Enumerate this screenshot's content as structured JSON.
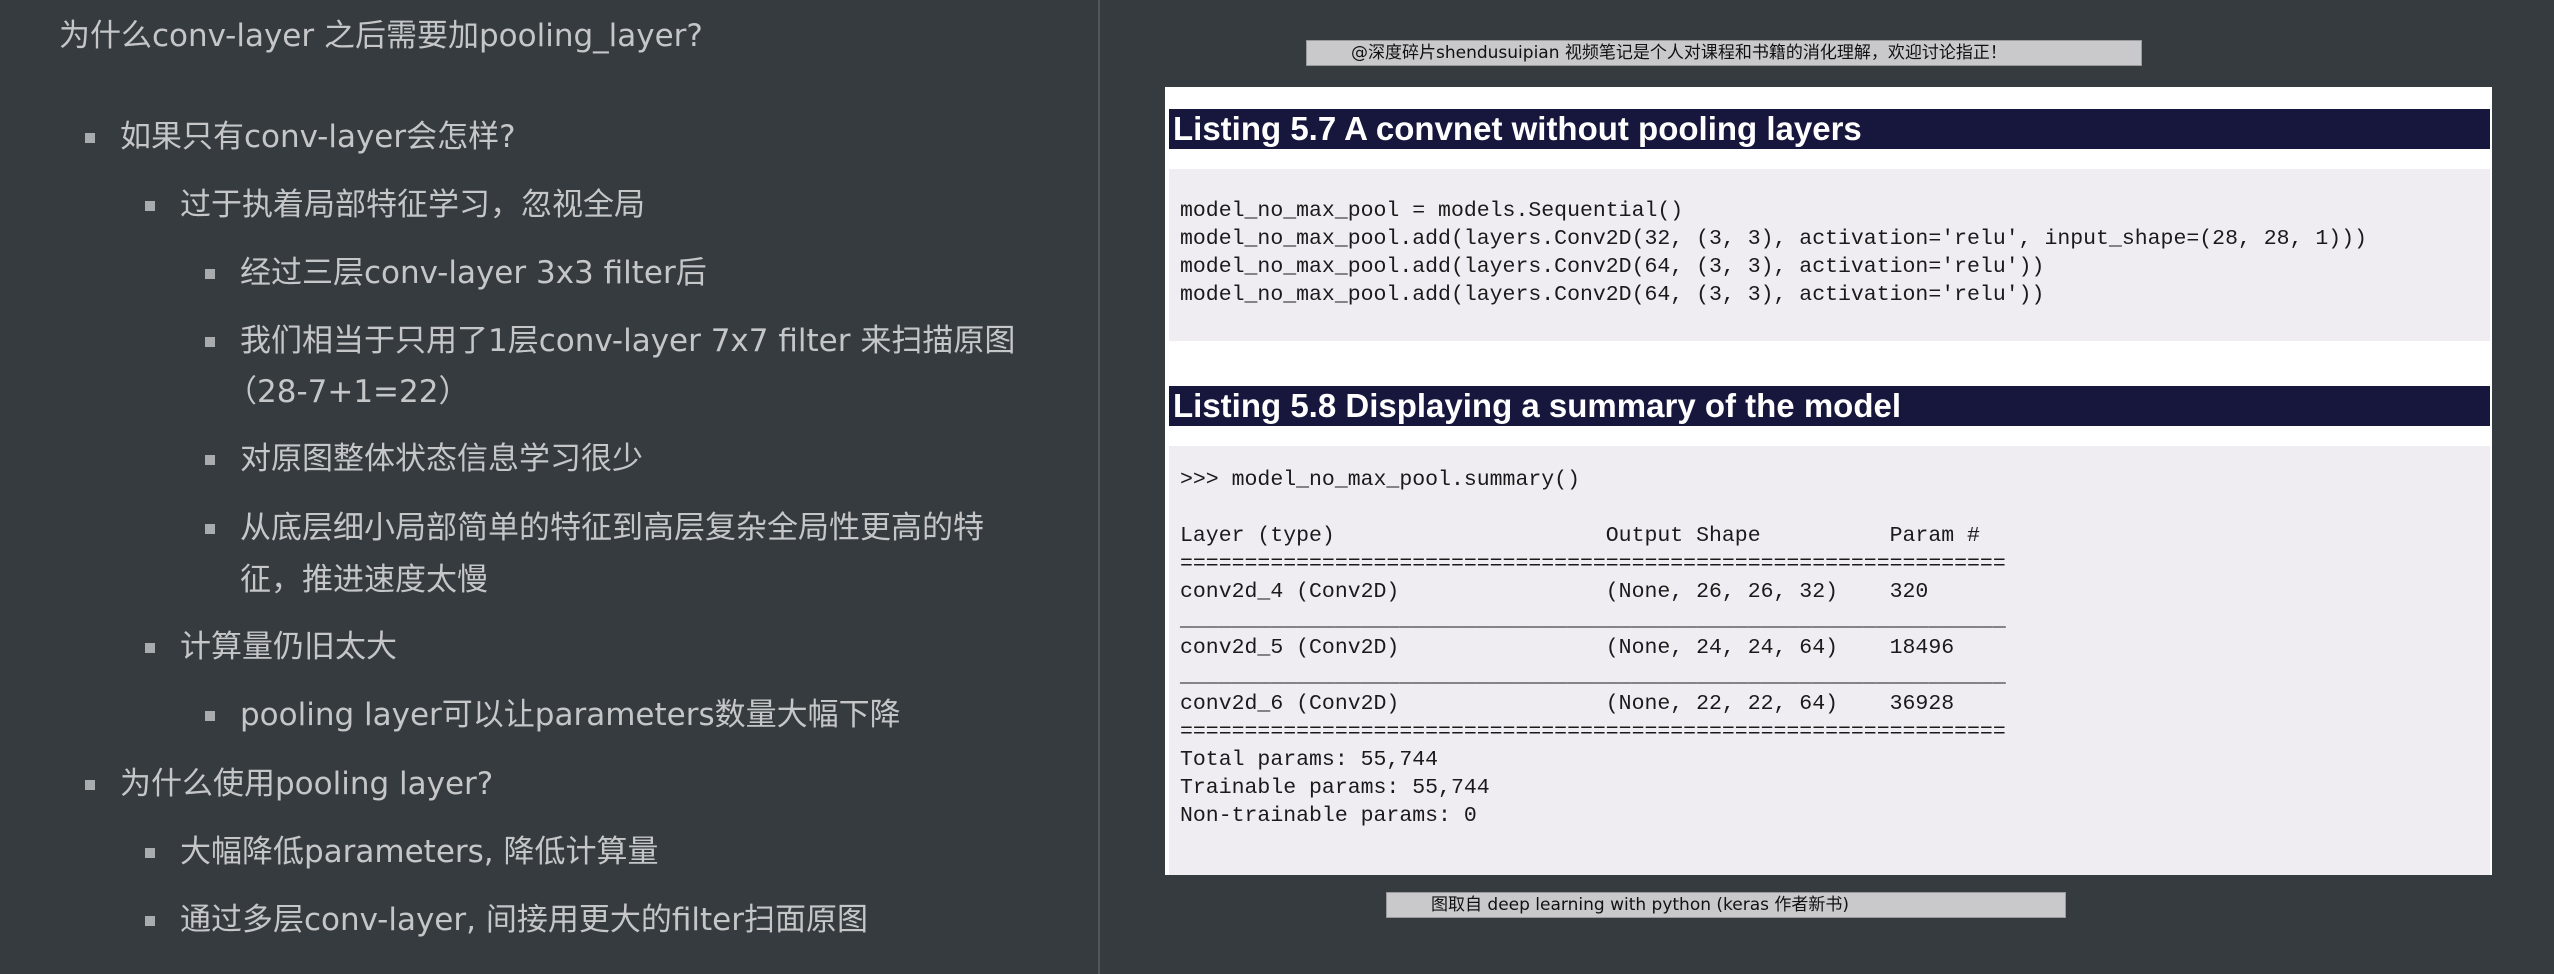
{
  "notes": {
    "title": "为什么conv-layer 之后需要加pooling_layer?",
    "items": [
      {
        "level": 1,
        "text": "如果只有conv-layer会怎样?"
      },
      {
        "level": 2,
        "text": "过于执着局部特征学习，忽视全局"
      },
      {
        "level": 3,
        "text": "经过三层conv-layer 3x3 filter后"
      },
      {
        "level": 3,
        "text": "我们相当于只用了1层conv-layer 7x7 filter 来扫描原图"
      },
      {
        "level": 3,
        "text": "（28-7+1=22）",
        "continuation": true
      },
      {
        "level": 3,
        "text": "对原图整体状态信息学习很少"
      },
      {
        "level": 3,
        "text": "从底层细小局部简单的特征到高层复杂全局性更高的特"
      },
      {
        "level": 3,
        "text": "征，推进速度太慢",
        "continuation": true
      },
      {
        "level": 2,
        "text": "计算量仍旧太大"
      },
      {
        "level": 3,
        "text": "pooling layer可以让parameters数量大幅下降"
      },
      {
        "level": 1,
        "text": "为什么使用pooling layer?"
      },
      {
        "level": 2,
        "text": "大幅降低parameters, 降低计算量"
      },
      {
        "level": 2,
        "text": "通过多层conv-layer, 间接用更大的filter扫面原图"
      }
    ]
  },
  "book": {
    "watermark": "@深度碎片shendusuipian 视频笔记是个人对课程和书籍的消化理解，欢迎讨论指正！",
    "caption": "图取自 deep learning with python (keras 作者新书)",
    "listing_57": {
      "title": "Listing 5.7 A convnet without pooling layers",
      "code": [
        "model_no_max_pool = models.Sequential()",
        "model_no_max_pool.add(layers.Conv2D(32, (3, 3), activation='relu', input_shape=(28, 28, 1)))",
        "model_no_max_pool.add(layers.Conv2D(64, (3, 3), activation='relu'))",
        "model_no_max_pool.add(layers.Conv2D(64, (3, 3), activation='relu'))"
      ]
    },
    "listing_58": {
      "title": "Listing 5.8 Displaying a summary of the model",
      "code": [
        ">>> model_no_max_pool.summary()",
        "",
        "Layer (type)                     Output Shape          Param #",
        "================================================================",
        "conv2d_4 (Conv2D)                (None, 26, 26, 32)    320",
        "________________________________________________________________",
        "conv2d_5 (Conv2D)                (None, 24, 24, 64)    18496",
        "________________________________________________________________",
        "conv2d_6 (Conv2D)                (None, 22, 22, 64)    36928",
        "================================================================",
        "Total params: 55,744",
        "Trainable params: 55,744",
        "Non-trainable params: 0"
      ]
    }
  }
}
